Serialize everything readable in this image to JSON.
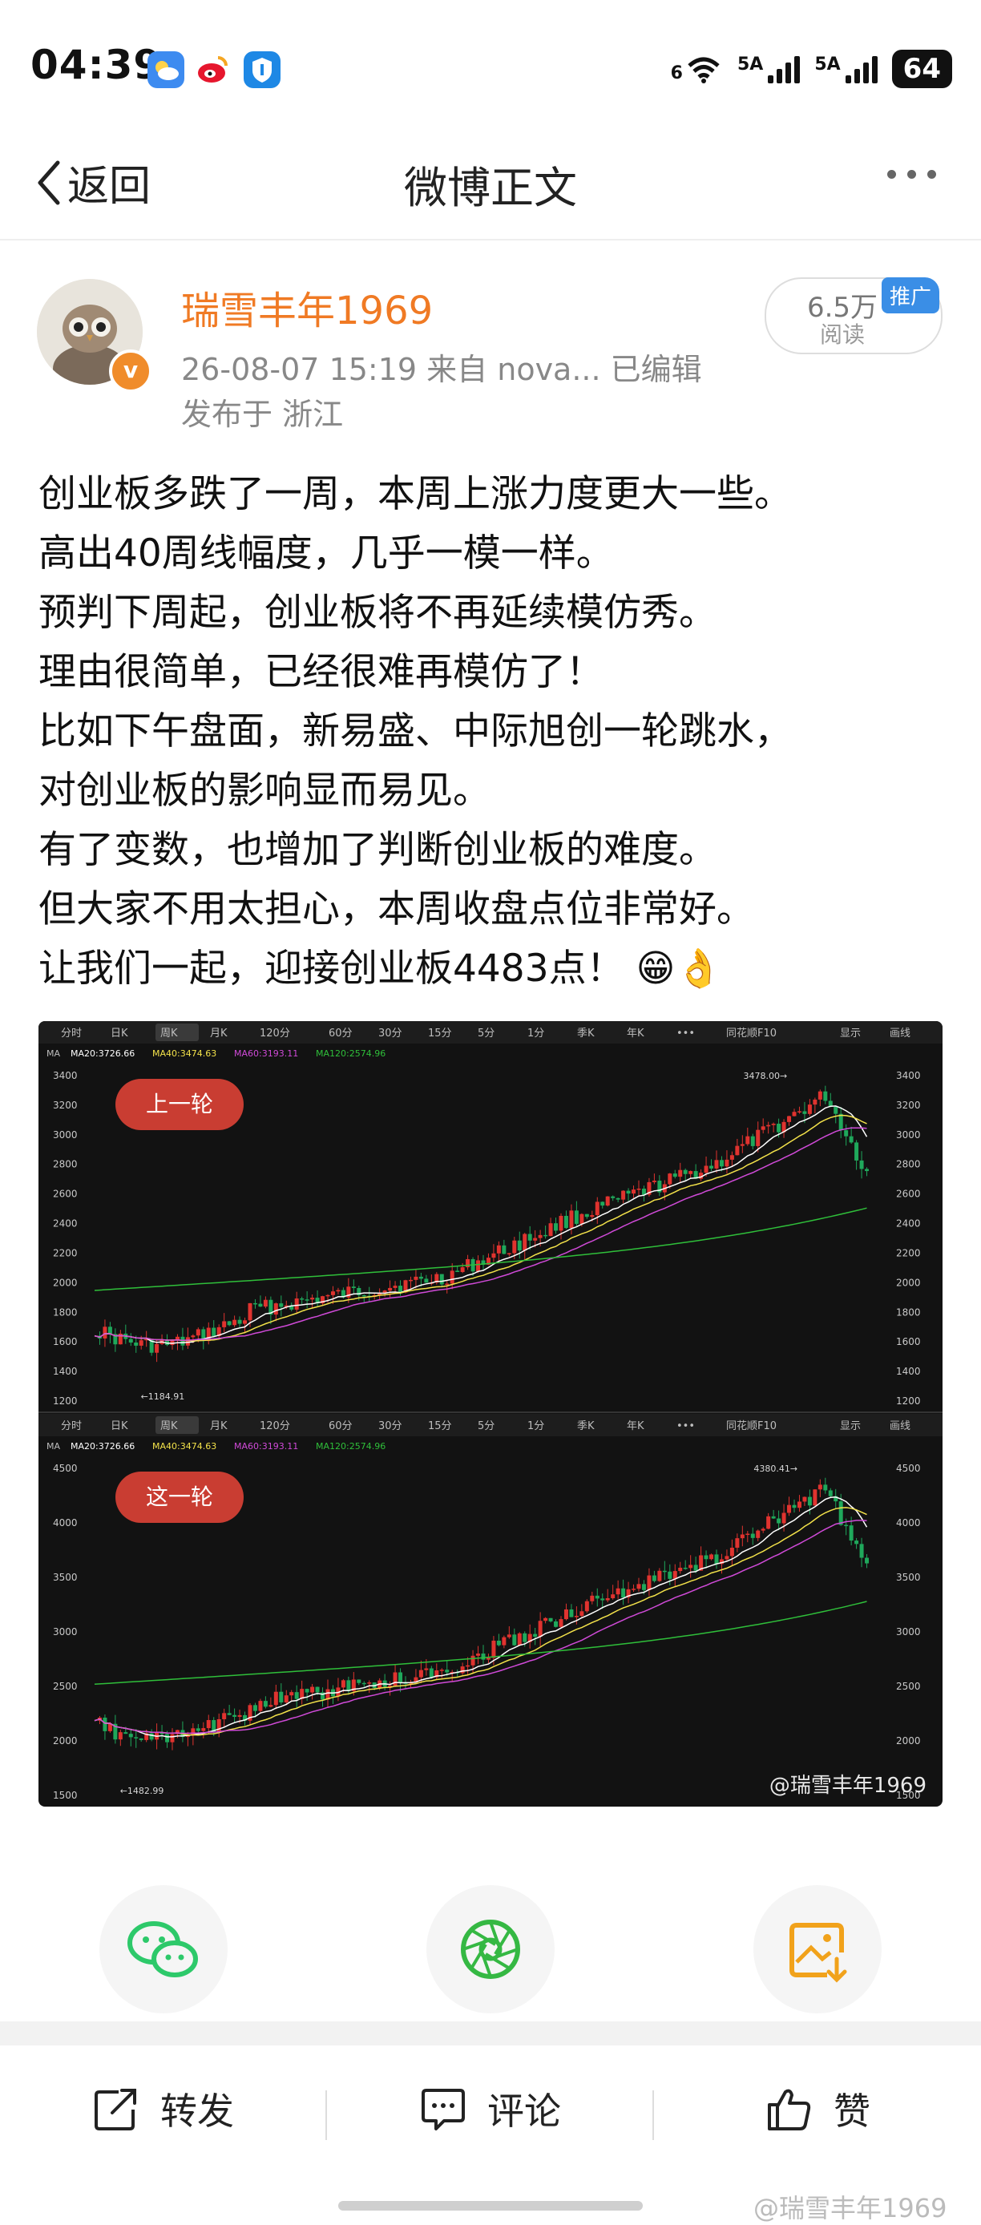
{
  "status_bar": {
    "time": "04:39",
    "wifi_label": "6",
    "sim1": "5A",
    "sim2": "5A",
    "battery": "64"
  },
  "nav": {
    "back_label": "返回",
    "title": "微博正文"
  },
  "author": {
    "name": "瑞雪丰年1969",
    "meta": "26-08-07 15:19  来自 nova...    已编辑",
    "location": "发布于 浙江",
    "verified_badge": "v",
    "reads_count": "6.5万",
    "reads_label": "阅读",
    "promo_tag": "推广"
  },
  "post": {
    "lines": [
      "创业板多跌了一周，本周上涨力度更大一些。",
      "高出40周线幅度，几乎一模一样。",
      "预判下周起，创业板将不再延续模仿秀。",
      "理由很简单，已经很难再模仿了！",
      "比如下午盘面，新易盛、中际旭创一轮跳水，",
      "对创业板的影响显而易见。",
      "有了变数，也增加了判断创业板的难度。",
      "但大家不用太担心，本周收盘点位非常好。",
      "让我们一起，迎接创业板4483点！ 😁👌"
    ]
  },
  "chart_image": {
    "toolbar_tabs": [
      "分时",
      "日K",
      "周K",
      "月K",
      "120分",
      "60分",
      "30分",
      "15分",
      "5分",
      "1分",
      "季K",
      "年K",
      "•••",
      "同花顺F10",
      "显示",
      "画线"
    ],
    "ma_legend": [
      "MA",
      "MA20:3726.66",
      "MA40:3474.63",
      "MA60:3193.11",
      "MA120:2574.96"
    ],
    "top": {
      "badge": "上一轮",
      "y_ticks": [
        "3400",
        "3200",
        "3000",
        "2800",
        "2600",
        "2400",
        "2200",
        "2000",
        "1800",
        "1600",
        "1400",
        "1200"
      ],
      "high_label": "3478.00→",
      "low_label": "←1184.91"
    },
    "bottom": {
      "badge": "这一轮",
      "y_ticks": [
        "4500",
        "4000",
        "3500",
        "3000",
        "2500",
        "2000",
        "1500"
      ],
      "high_label": "4380.41→",
      "low_label": "←1482.99"
    },
    "watermark": "@瑞雪丰年1969",
    "colors": {
      "up": "#e0332f",
      "down": "#1fa85b",
      "ma20": "#ffffff",
      "ma40": "#f3e24a",
      "ma60": "#d04ad8",
      "ma120": "#2fbf3a",
      "badge": "#c93d32"
    }
  },
  "share": {
    "wechat": "wechat-icon",
    "moments": "moments-icon",
    "save_image": "save-image-icon"
  },
  "actions": {
    "repost": "转发",
    "comment": "评论",
    "like": "赞"
  },
  "bottom_watermark": "@瑞雪丰年1969"
}
